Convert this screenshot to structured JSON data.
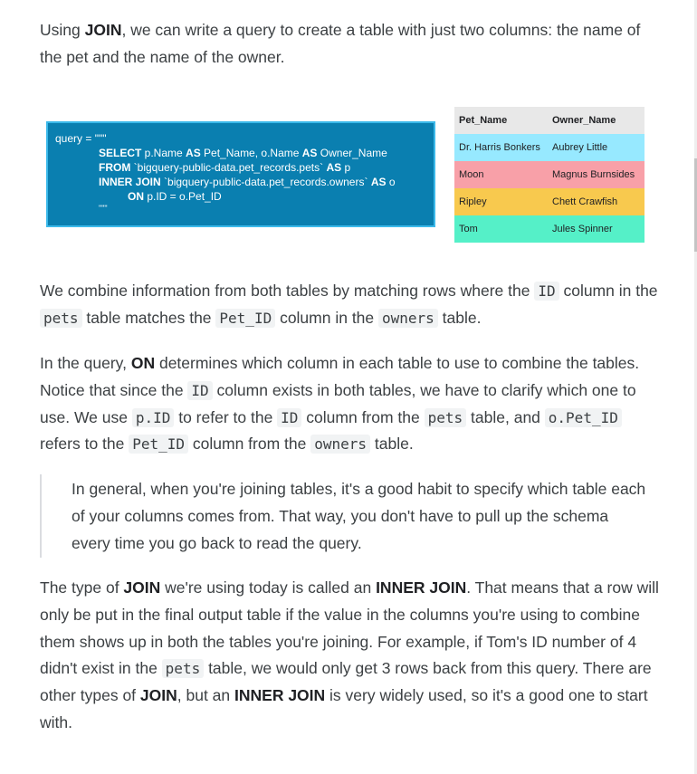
{
  "intro": {
    "t1": "Using ",
    "b1": "JOIN",
    "t2": ", we can write a query to create a table with just two columns: the name of the pet and the name of the owner."
  },
  "figure": {
    "query_lines": {
      "l1_a": "query = \"\"\"",
      "l2_kw": "SELECT",
      "l2_a": " p.Name ",
      "l2_kw2": "AS",
      "l2_b": " Pet_Name, o.Name ",
      "l2_kw3": "AS",
      "l2_c": " Owner_Name",
      "l3_kw": "FROM",
      "l3_a": " `bigquery-public-data.pet_records.pets` ",
      "l3_kw2": "AS",
      "l3_b": " p",
      "l4_kw": "INNER JOIN",
      "l4_a": " `bigquery-public-data.pet_records.owners` ",
      "l4_kw2": "AS",
      "l4_b": " o",
      "l5_kw": "ON",
      "l5_a": " p.ID = o.Pet_ID",
      "l6_a": "\"\"\""
    },
    "table": {
      "headers": [
        "Pet_Name",
        "Owner_Name"
      ],
      "rows": [
        [
          "Dr. Harris Bonkers",
          "Aubrey Little"
        ],
        [
          "Moon",
          "Magnus Burnsides"
        ],
        [
          "Ripley",
          "Chett Crawfish"
        ],
        [
          "Tom",
          "Jules Spinner"
        ]
      ]
    }
  },
  "combine": {
    "t1": "We combine information from both tables by matching rows where the ",
    "c1": "ID",
    "t2": " column in the ",
    "c2": "pets",
    "t3": " table matches the ",
    "c3": "Pet_ID",
    "t4": " column in the ",
    "c4": "owners",
    "t5": " table."
  },
  "on_para": {
    "t1": "In the query, ",
    "b1": "ON",
    "t2": " determines which column in each table to use to combine the tables. Notice that since the ",
    "c1": "ID",
    "t3": " column exists in both tables, we have to clarify which one to use. We use ",
    "c2": "p.ID",
    "t4": " to refer to the ",
    "c3": "ID",
    "t5": " column from the ",
    "c4": "pets",
    "t6": " table, and ",
    "c5": "o.Pet_ID",
    "t7": " refers to the ",
    "c6": "Pet_ID",
    "t8": " column from the ",
    "c7": "owners",
    "t9": " table."
  },
  "quote": "In general, when you're joining tables, it's a good habit to specify which table each of your columns comes from. That way, you don't have to pull up the schema every time you go back to read the query.",
  "type_para": {
    "t1": "The type of ",
    "b1": "JOIN",
    "t2": " we're using today is called an ",
    "b2": "INNER JOIN",
    "t3": ". That means that a row will only be put in the final output table if the value in the columns you're using to combine them shows up in both the tables you're joining. For example, if Tom's ID number of 4 didn't exist in the ",
    "c1": "pets",
    "t4": " table, we would only get 3 rows back from this query. There are other types of ",
    "b3": "JOIN",
    "t5": ", but an ",
    "b4": "INNER JOIN",
    "t6": " is very widely used, so it's a good one to start with."
  }
}
